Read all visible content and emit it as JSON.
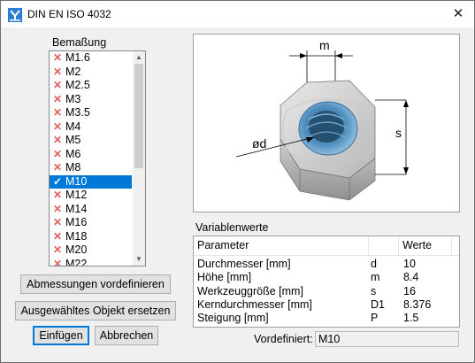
{
  "window": {
    "title": "DIN EN ISO 4032",
    "close_glyph": "✕"
  },
  "dimension_label": "Bemaßung",
  "list_items": [
    {
      "label": "M1.6",
      "status": "x"
    },
    {
      "label": "M2",
      "status": "x"
    },
    {
      "label": "M2.5",
      "status": "x"
    },
    {
      "label": "M3",
      "status": "x"
    },
    {
      "label": "M3.5",
      "status": "x"
    },
    {
      "label": "M4",
      "status": "x"
    },
    {
      "label": "M5",
      "status": "x"
    },
    {
      "label": "M6",
      "status": "x"
    },
    {
      "label": "M8",
      "status": "x"
    },
    {
      "label": "M10",
      "status": "ok",
      "selected": true
    },
    {
      "label": "M12",
      "status": "x"
    },
    {
      "label": "M14",
      "status": "x"
    },
    {
      "label": "M16",
      "status": "x"
    },
    {
      "label": "M18",
      "status": "x"
    },
    {
      "label": "M20",
      "status": "x"
    },
    {
      "label": "M22",
      "status": "x"
    }
  ],
  "scroll": {
    "up": "▲",
    "down": "▼"
  },
  "buttons": {
    "predefine": "Abmessungen vordefinieren",
    "replace": "Ausgewähltes Objekt ersetzen",
    "insert": "Einfügen",
    "cancel": "Abbrechen"
  },
  "diagram": {
    "label_m": "m",
    "label_d": "ød",
    "label_s": "s"
  },
  "variables": {
    "title": "Variablenwerte",
    "headers": {
      "parameter": "Parameter",
      "values": "Werte"
    },
    "rows": [
      {
        "name": "Durchmesser [mm]",
        "symbol": "d",
        "value": "10"
      },
      {
        "name": "Höhe [mm]",
        "symbol": "m",
        "value": "8.4"
      },
      {
        "name": "Werkzeuggröße [mm]",
        "symbol": "s",
        "value": "16"
      },
      {
        "name": "Kerndurchmesser [mm]",
        "symbol": "D1",
        "value": "8.376"
      },
      {
        "name": "Steigung [mm]",
        "symbol": "P",
        "value": "1.5"
      }
    ]
  },
  "predefined": {
    "label": "Vordefiniert:",
    "value": "M10"
  },
  "colors": {
    "selection": "#0078d7",
    "x_mark": "#e15c5c",
    "check_mark": "#1a8c2a"
  }
}
